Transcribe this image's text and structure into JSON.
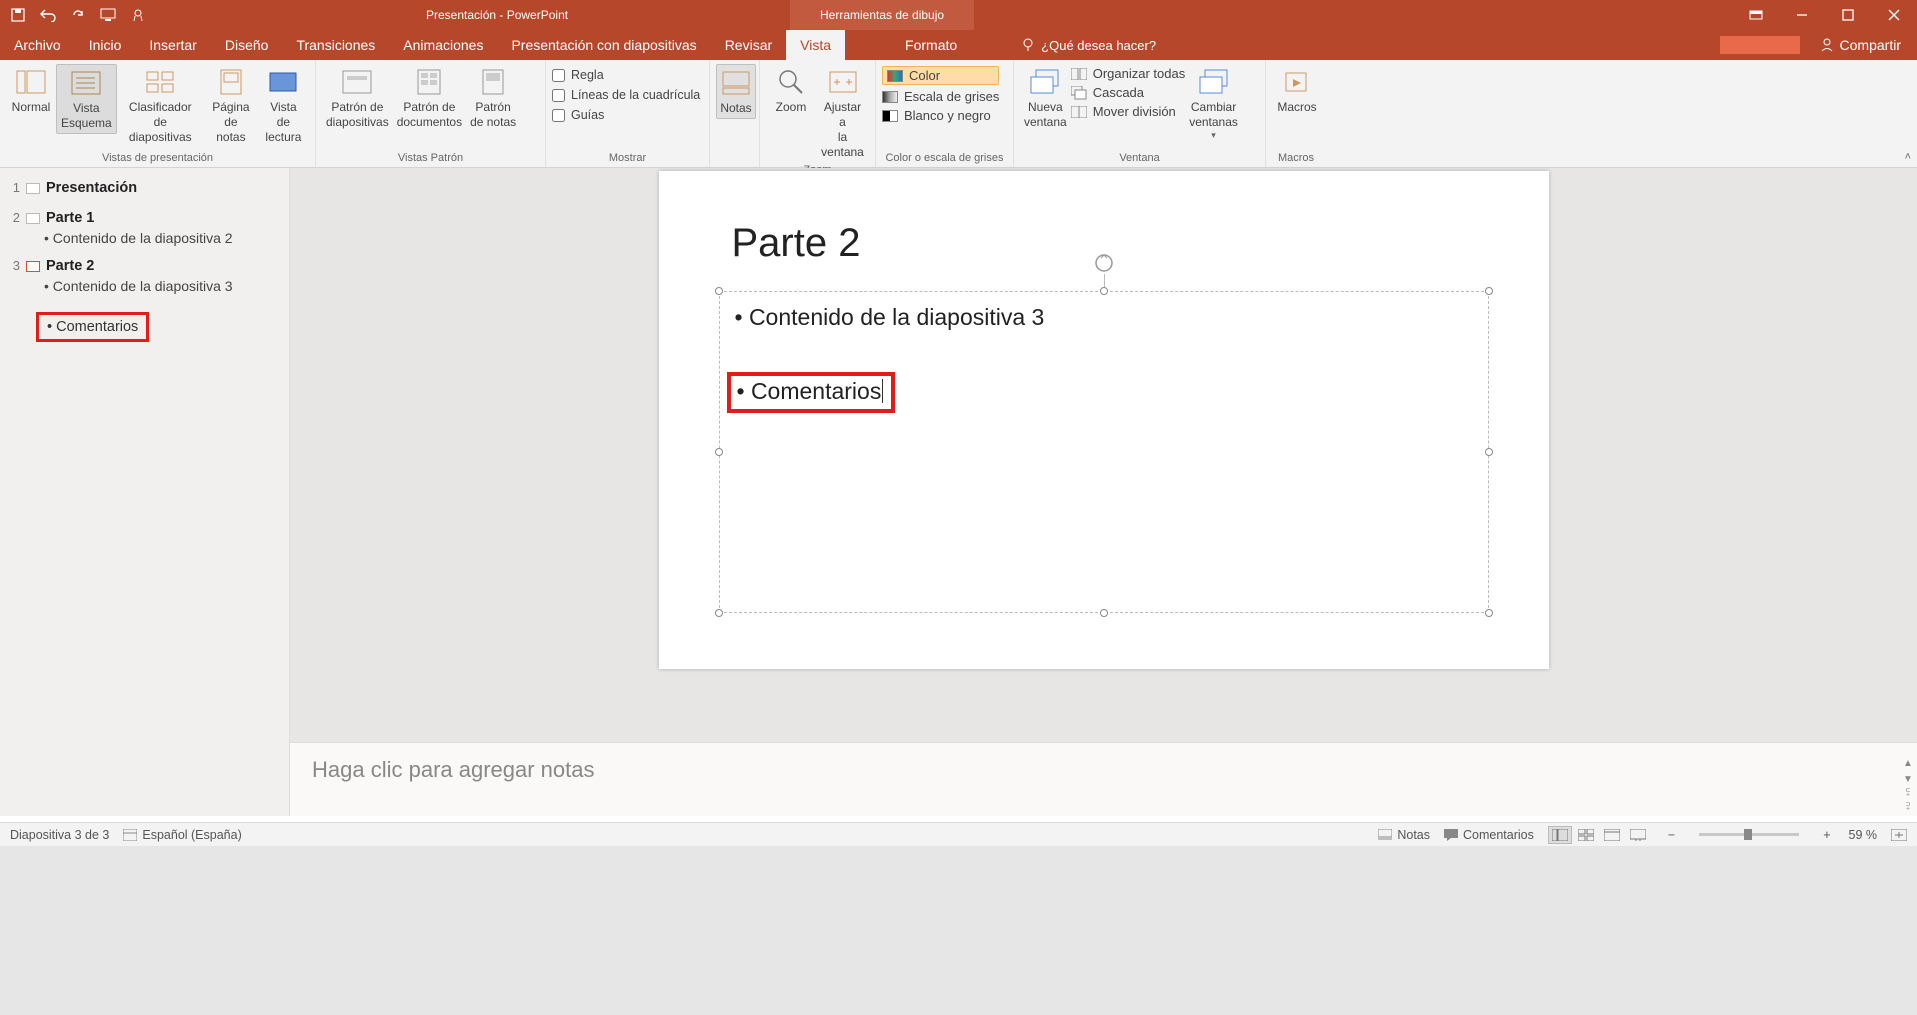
{
  "window": {
    "title": "Presentación - PowerPoint",
    "contextual_tab": "Herramientas de dibujo"
  },
  "tabs": {
    "archivo": "Archivo",
    "inicio": "Inicio",
    "insertar": "Insertar",
    "diseno": "Diseño",
    "transiciones": "Transiciones",
    "animaciones": "Animaciones",
    "presentacion": "Presentación con diapositivas",
    "revisar": "Revisar",
    "vista": "Vista",
    "formato": "Formato",
    "tellme": "¿Qué desea hacer?",
    "compartir": "Compartir"
  },
  "ribbon": {
    "groups": {
      "vistas_presentacion": "Vistas de presentación",
      "vistas_patron": "Vistas Patrón",
      "mostrar": "Mostrar",
      "zoom": "Zoom",
      "color": "Color o escala de grises",
      "ventana": "Ventana",
      "macros": "Macros"
    },
    "buttons": {
      "normal": "Normal",
      "esquema": "Vista\nEsquema",
      "clasificador": "Clasificador de\ndiapositivas",
      "pagina_notas": "Página\nde notas",
      "vista_lectura": "Vista de\nlectura",
      "patron_diap": "Patrón de\ndiapositivas",
      "patron_doc": "Patrón de\ndocumentos",
      "patron_notas": "Patrón\nde notas",
      "regla": "Regla",
      "cuadricula": "Líneas de la cuadrícula",
      "guias": "Guías",
      "notas": "Notas",
      "zoom": "Zoom",
      "ajustar": "Ajustar a\nla ventana",
      "color": "Color",
      "grises": "Escala de grises",
      "byn": "Blanco y negro",
      "nueva_ventana": "Nueva\nventana",
      "organizar": "Organizar todas",
      "cascada": "Cascada",
      "mover_div": "Mover división",
      "cambiar_ventanas": "Cambiar\nventanas",
      "macros": "Macros"
    }
  },
  "outline": {
    "slide1": {
      "num": "1",
      "title": "Presentación"
    },
    "slide2": {
      "num": "2",
      "title": "Parte 1",
      "sub": "• Contenido de la diapositiva 2"
    },
    "slide3": {
      "num": "3",
      "title": "Parte 2",
      "sub": "• Contenido de la diapositiva 3",
      "extra": "• Comentarios"
    }
  },
  "slide": {
    "title": "Parte 2",
    "bullet1": "• Contenido de la diapositiva 3",
    "bullet2": "• Comentarios"
  },
  "notes": {
    "placeholder": "Haga clic para agregar notas"
  },
  "status": {
    "slide_of": "Diapositiva 3 de 3",
    "lang": "Español (España)",
    "notas": "Notas",
    "comentarios": "Comentarios",
    "zoom_pct": "59 %"
  }
}
